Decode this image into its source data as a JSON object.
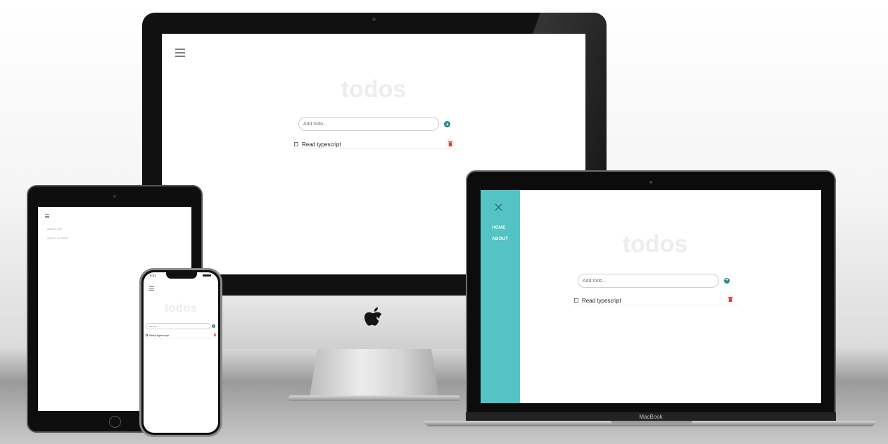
{
  "app": {
    "title": "todos",
    "input_placeholder": "Add todo...",
    "add_button_label": "+",
    "todo_items": [
      {
        "label": "Read typescript",
        "completed": false
      }
    ]
  },
  "sidebar": {
    "links": [
      {
        "label": "HOME"
      },
      {
        "label": "ABOUT"
      }
    ]
  },
  "tablet_menu": {
    "links": [
      {
        "label": "ABOUT APP"
      },
      {
        "label": "ABOUT AUTHOR"
      }
    ]
  },
  "phone_status": {
    "time": "9:41"
  },
  "laptop_brand": "MacBook",
  "colors": {
    "sidebar": "#54c3c3",
    "add_button": "#1d8a8a",
    "delete_icon": "#e53935",
    "title_text": "#ededed"
  },
  "icons": [
    "hamburger-menu-icon",
    "close-icon",
    "plus-circle-icon",
    "trash-icon",
    "apple-logo-icon"
  ]
}
